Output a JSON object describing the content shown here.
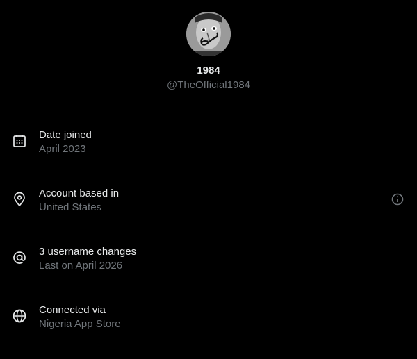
{
  "profile": {
    "display_name": "1984",
    "handle": "@TheOfficial1984",
    "avatar_icon": "profile-photo"
  },
  "rows": [
    {
      "icon": "calendar-icon",
      "title": "Date joined",
      "subtitle": "April 2023"
    },
    {
      "icon": "location-pin-icon",
      "title": "Account based in",
      "subtitle": "United States",
      "action_icon": "info-icon"
    },
    {
      "icon": "at-sign-icon",
      "title": "3 username changes",
      "subtitle": "Last on April 2026"
    },
    {
      "icon": "globe-icon",
      "title": "Connected via",
      "subtitle": "Nigeria App Store"
    }
  ],
  "colors": {
    "background": "#000000",
    "primary_text": "#e7e9ea",
    "secondary_text": "#71767b"
  }
}
